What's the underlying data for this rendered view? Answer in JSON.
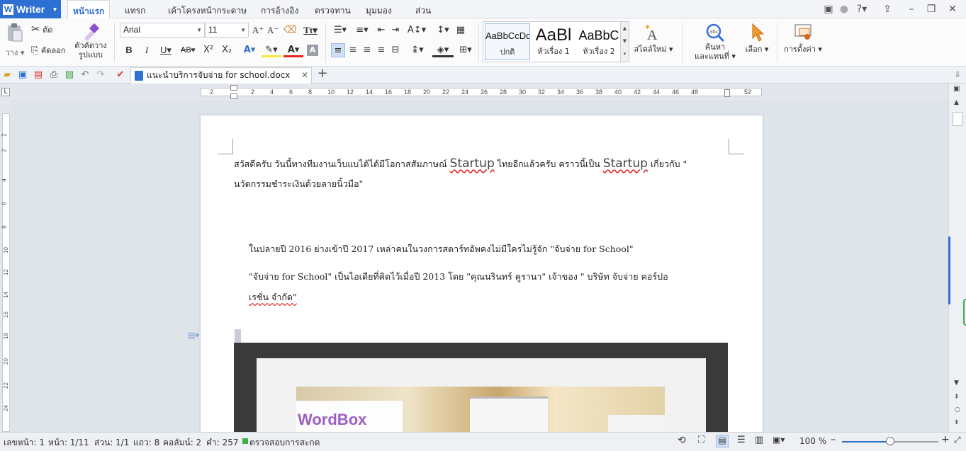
{
  "app": {
    "name": "Writer"
  },
  "menu": {
    "tabs": [
      "หน้าแรก",
      "แทรก",
      "เค้าโครงหน้ากระดาษ",
      "การอ้างอิง",
      "ตรวจทาน",
      "มุมมอง",
      "ส่วน"
    ],
    "active_tab": "หน้าแรก"
  },
  "ribbon": {
    "paste": "วาง",
    "cut": "ตัด",
    "copy": "คัดลอก",
    "format_painter": "ตัวคัดวาง",
    "format_painter_2": "รูปแบบ",
    "font_name": "Arial",
    "font_size": "11",
    "styles": [
      {
        "preview": "AaBbCcDd",
        "name": "ปกติ"
      },
      {
        "preview": "AaBl",
        "name": "หัวเรื่อง 1"
      },
      {
        "preview": "AaBbC",
        "name": "หัวเรื่อง 2"
      }
    ],
    "new_style": "สไตล์ใหม่",
    "find_replace": "ค้นหา",
    "find_replace_2": "และแทนที่",
    "select": "เลือก",
    "settings": "การตั้งค่า"
  },
  "document_tab": {
    "title": "แนะนำบริการจับจ่าย for school.docx"
  },
  "ruler": {
    "marks": [
      "2",
      "2",
      "4",
      "6",
      "8",
      "10",
      "12",
      "14",
      "16",
      "18",
      "20",
      "22",
      "24",
      "26",
      "28",
      "30",
      "32",
      "34",
      "36",
      "38",
      "40",
      "42",
      "44",
      "46",
      "48",
      "52"
    ]
  },
  "vruler": {
    "marks": [
      "2",
      "2",
      "4",
      "6",
      "8",
      "10",
      "12",
      "14",
      "16",
      "18",
      "20",
      "22",
      "24"
    ]
  },
  "document": {
    "para1_a": "สวัสดีครับ วันนี้ทางทีมงานเว็บแบไต้ได้มีโอกาสสัมภาษณ์",
    "para1_b": "Startup",
    "para1_c": "ไทยอีกแล้วครับ คราวนี้เป็น",
    "para1_d": "Startup",
    "para1_e": "เกี่ยวกับ \"",
    "para1_line2": "นวัตกรรมชำระเงินด้วยลายนิ้วมือ\"",
    "para2": "ในปลายปี 2016 ย่างเข้าปี 2017 เหล่าคนในวงการสตาร์ทอัพคงไม่มีใครไม่รู้จัก \"จับจ่าย for School\"",
    "para3_line1": "\"จับจ่าย for School\"    เป็นไอเดียที่คิดไว้เมื่อปี 2013    โดย \"คุณนรินทร์ คูรานา\" เจ้าของ \"  บริษัท จับจ่าย คอร์ปอ",
    "para3_line2": "เรชั่น จำกัด\"",
    "image_text": "WordBox"
  },
  "status": {
    "page_number": "เลขหน้า: 1",
    "page": "หน้า: 1/11",
    "section": "ส่วน: 1/1",
    "line": "แถว: 8",
    "column": "คอลัมน์: 2",
    "words": "คำ: 257",
    "spellcheck": "ตรวจสอบการสะกด",
    "zoom": "100 %",
    "zoom_level": 0.5
  },
  "colors": {
    "accent": "#2e6fd2",
    "squiggle": "#dd3333"
  }
}
